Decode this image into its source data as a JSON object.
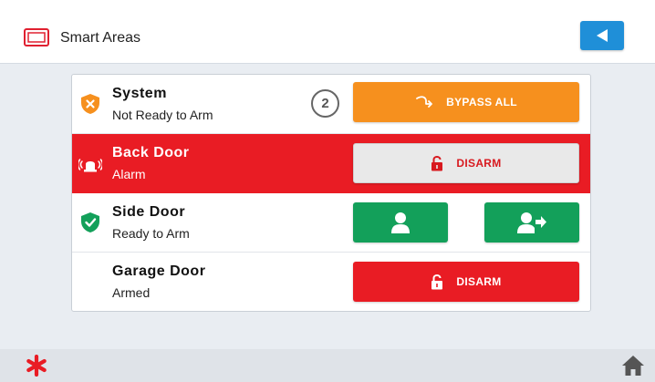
{
  "header": {
    "title": "Smart Areas"
  },
  "rows": [
    {
      "name": "System",
      "status": "Not Ready to Arm",
      "count": "2",
      "action_label": "BYPASS ALL"
    },
    {
      "name": "Back Door",
      "status": "Alarm",
      "action_label": "DISARM"
    },
    {
      "name": "Side Door",
      "status": "Ready to Arm"
    },
    {
      "name": "Garage Door",
      "status": "Armed",
      "action_label": "DISARM"
    }
  ],
  "colors": {
    "alarm_red": "#e91c24",
    "bypass_orange": "#f6901e",
    "arm_green": "#13a05a",
    "back_blue": "#1f8fd8"
  }
}
